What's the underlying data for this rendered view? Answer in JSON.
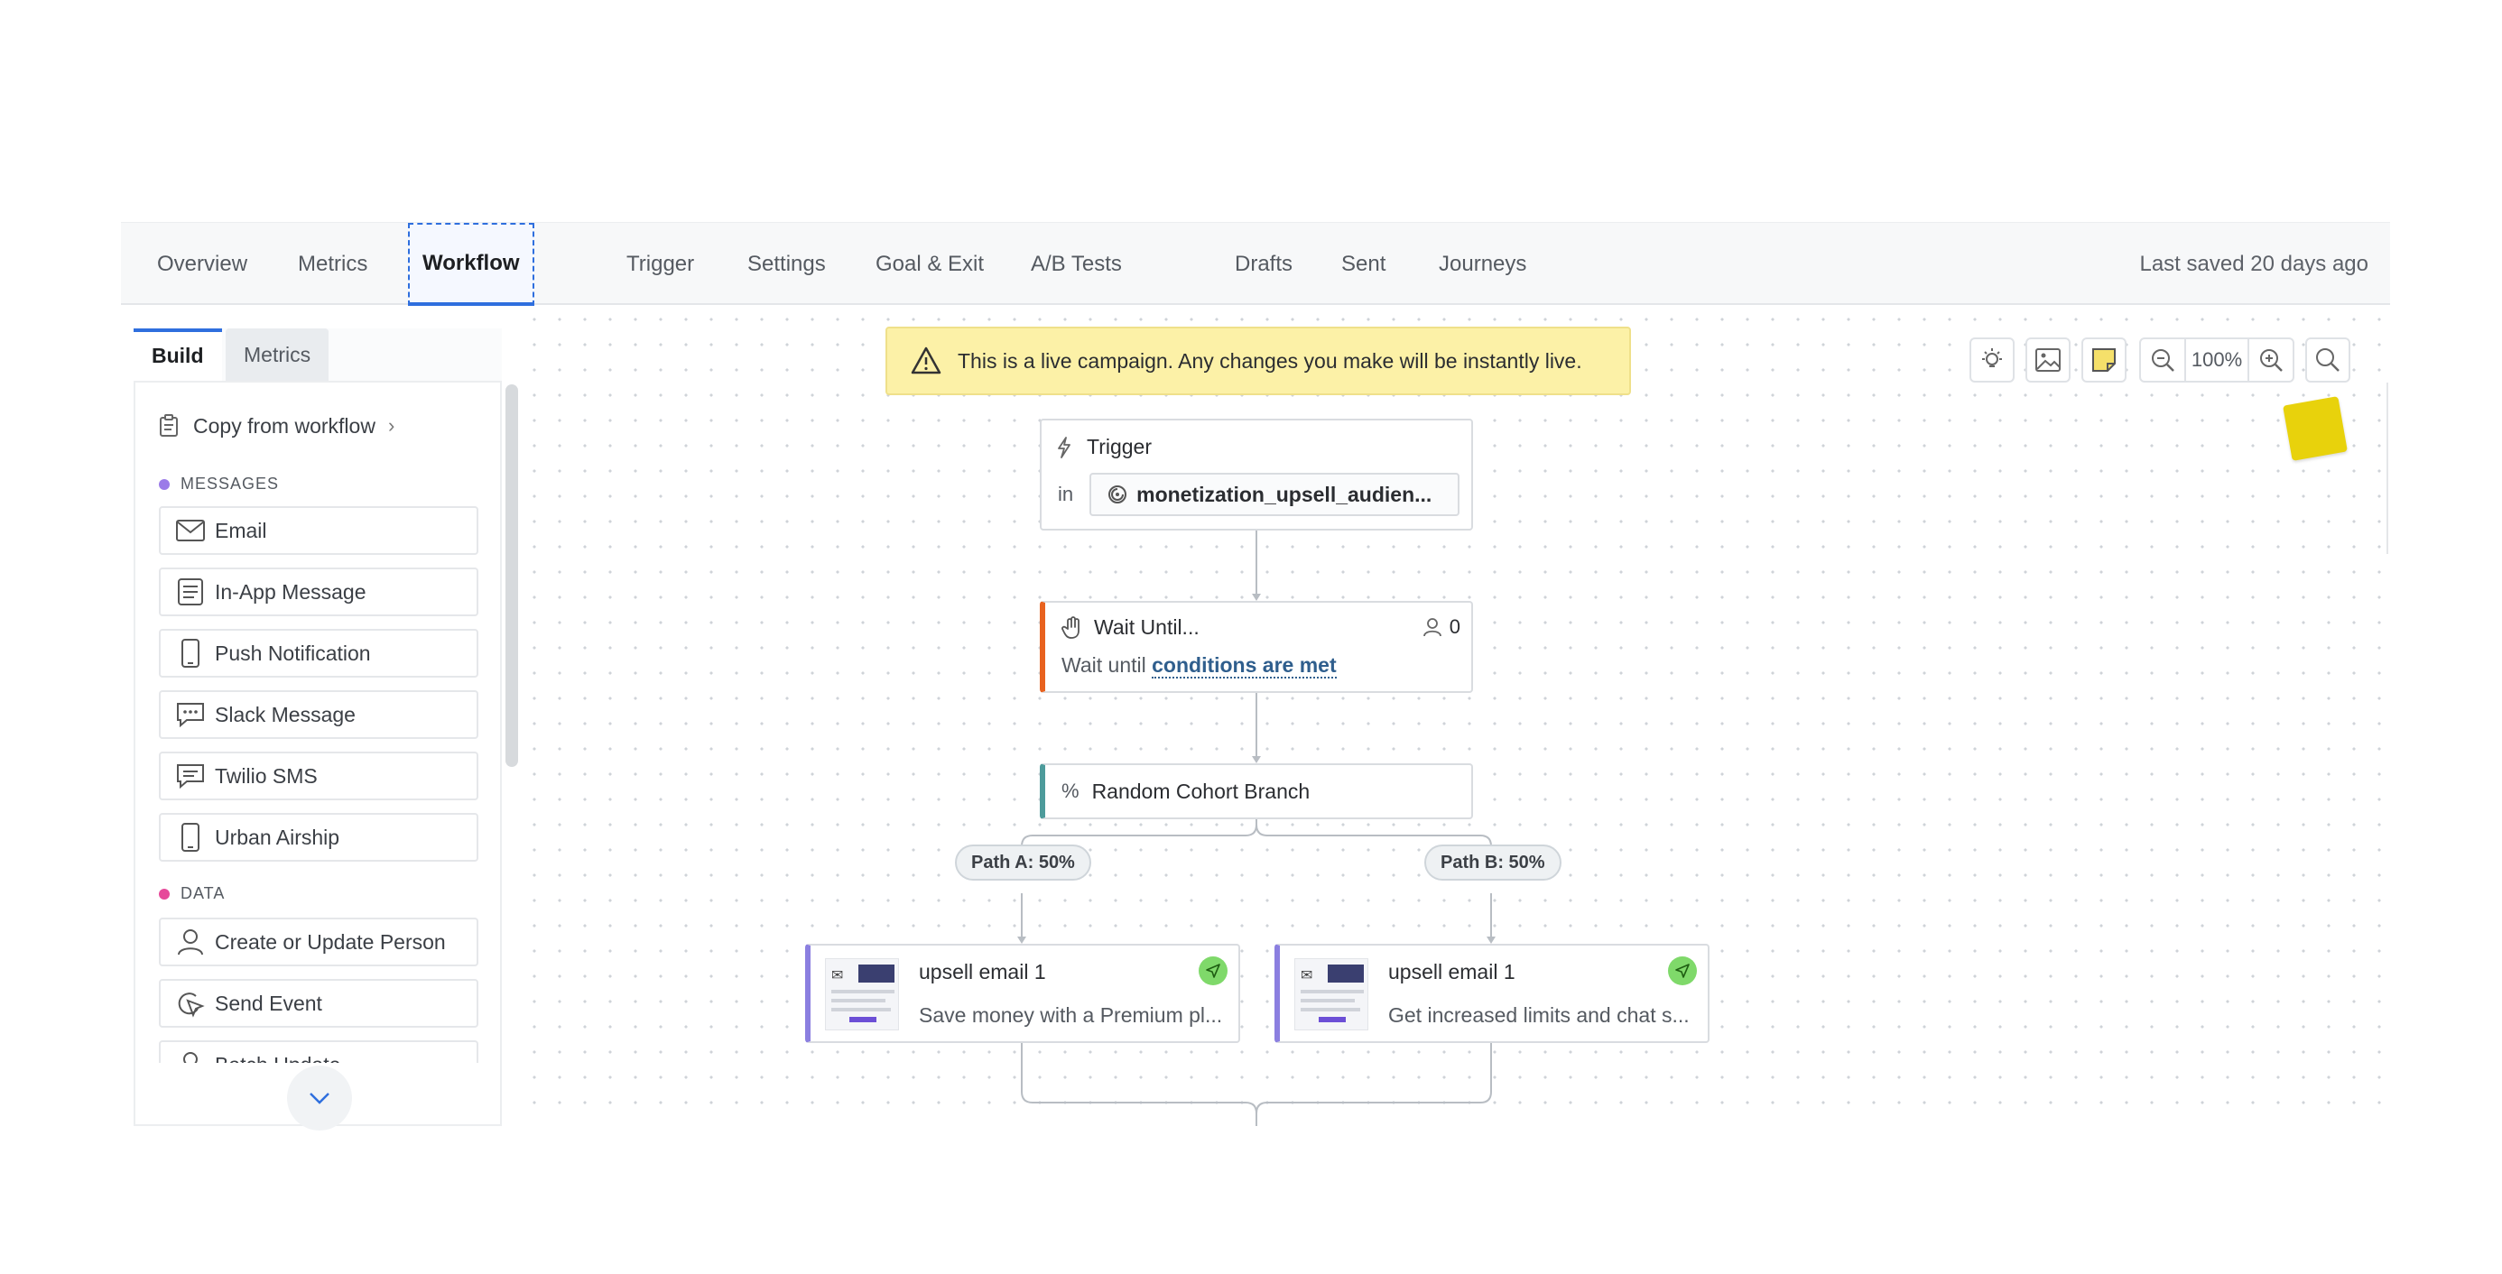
{
  "topnav": {
    "tabs": [
      {
        "label": "Overview"
      },
      {
        "label": "Metrics"
      },
      {
        "label": "Workflow"
      },
      {
        "label": "Trigger"
      },
      {
        "label": "Settings"
      },
      {
        "label": "Goal & Exit"
      },
      {
        "label": "A/B Tests"
      },
      {
        "label": "Drafts"
      },
      {
        "label": "Sent"
      },
      {
        "label": "Journeys"
      }
    ],
    "active_tab": "Workflow",
    "last_saved": "Last saved 20 days ago"
  },
  "sidebar": {
    "tabs": [
      {
        "label": "Build"
      },
      {
        "label": "Metrics"
      }
    ],
    "copy_from_workflow": "Copy from workflow",
    "sections": [
      {
        "label": "MESSAGES",
        "color": "#9b7be8",
        "items": [
          {
            "label": "Email",
            "icon": "envelope-icon"
          },
          {
            "label": "In-App Message",
            "icon": "in-app-message-icon"
          },
          {
            "label": "Push Notification",
            "icon": "mobile-phone-icon"
          },
          {
            "label": "Slack Message",
            "icon": "chat-bubble-icon"
          },
          {
            "label": "Twilio SMS",
            "icon": "sms-icon"
          },
          {
            "label": "Urban Airship",
            "icon": "mobile-phone-icon"
          }
        ]
      },
      {
        "label": "DATA",
        "color": "#e64a9a",
        "items": [
          {
            "label": "Create or Update Person",
            "icon": "person-icon"
          },
          {
            "label": "Send Event",
            "icon": "cursor-click-icon"
          },
          {
            "label": "Batch Update",
            "icon": "person-icon"
          }
        ]
      }
    ]
  },
  "canvas": {
    "banner": "This is a live campaign. Any changes you make will be instantly live.",
    "zoom": "100%",
    "trigger": {
      "title": "Trigger",
      "in_label": "in",
      "segment": "monetization_upsell_audien..."
    },
    "wait": {
      "title": "Wait Until...",
      "count": "0",
      "prefix": "Wait until",
      "link": "conditions are met"
    },
    "branch": {
      "title": "Random Cohort Branch"
    },
    "paths": [
      {
        "label": "Path A: 50%"
      },
      {
        "label": "Path B: 50%"
      }
    ],
    "emails": [
      {
        "title": "upsell email 1",
        "subject": "Save money with a Premium pl..."
      },
      {
        "title": "upsell email 1",
        "subject": "Get increased limits and chat s..."
      }
    ]
  },
  "colors": {
    "accent": "#2f6fde",
    "banner": "#fcf1a7",
    "wait_bar": "#e8621e",
    "branch_bar": "#4d9b9b",
    "email_bar": "#8b7fe0",
    "sent_badge": "#7fd96a",
    "sticky_note": "#e8d20c"
  }
}
